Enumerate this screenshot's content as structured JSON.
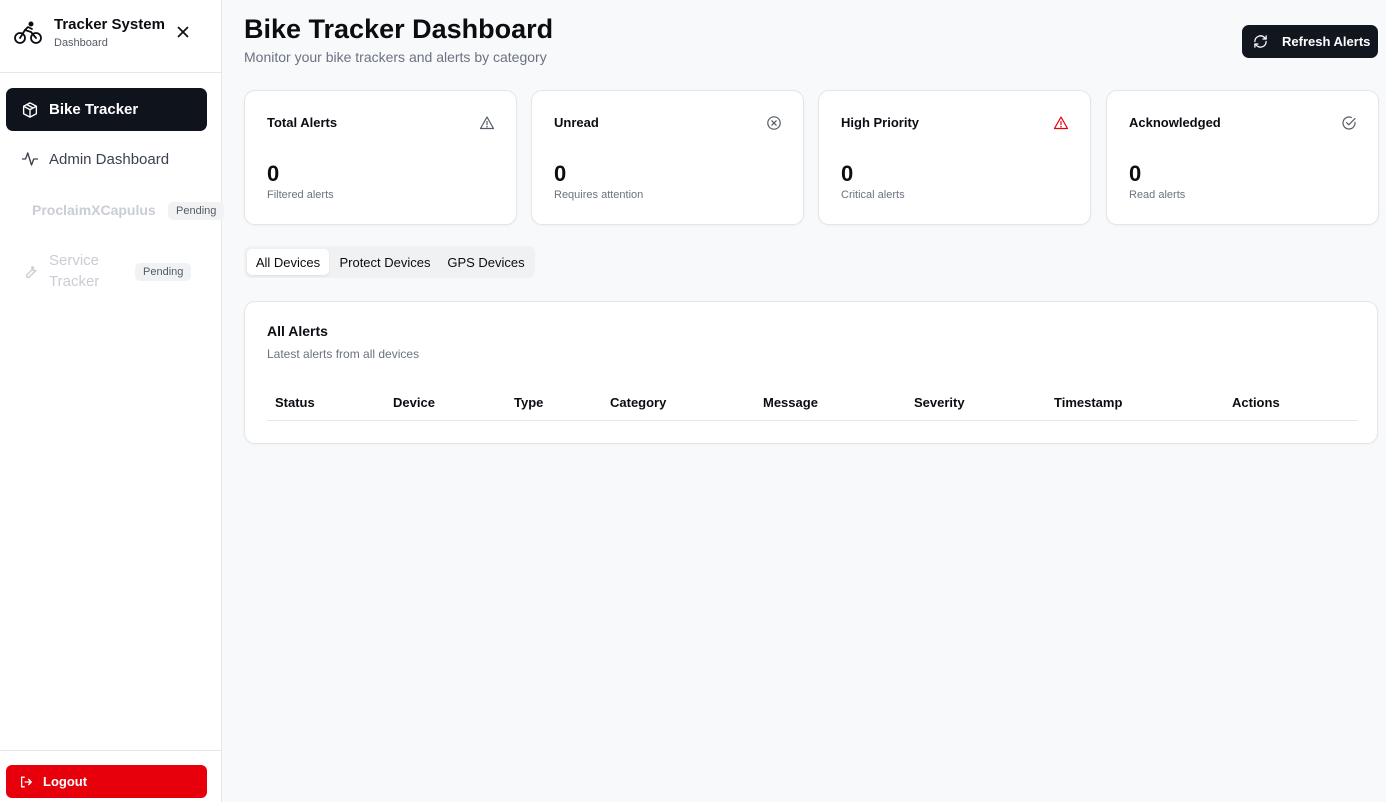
{
  "sidebar": {
    "brand": {
      "title": "Tracker System",
      "subtitle": "Dashboard",
      "icon": "bike-icon"
    },
    "items": [
      {
        "label": "Bike Tracker",
        "icon": "package-icon",
        "active": true
      },
      {
        "label": "Admin Dashboard",
        "icon": "activity-icon",
        "active": false
      },
      {
        "label": "ProclaimXCapulus",
        "badge": "Pending",
        "disabled": true
      },
      {
        "label": "Service Tracker",
        "icon": "wrench-icon",
        "badge": "Pending",
        "disabled": true
      }
    ],
    "logout_label": "Logout"
  },
  "header": {
    "title": "Bike Tracker Dashboard",
    "subtitle": "Monitor your bike trackers and alerts by category",
    "refresh_label": "Refresh Alerts"
  },
  "stats": [
    {
      "title": "Total Alerts",
      "value": "0",
      "note": "Filtered alerts",
      "icon": "alert-triangle-icon"
    },
    {
      "title": "Unread",
      "value": "0",
      "note": "Requires attention",
      "icon": "x-circle-icon"
    },
    {
      "title": "High Priority",
      "value": "0",
      "note": "Critical alerts",
      "icon": "alert-triangle-red-icon"
    },
    {
      "title": "Acknowledged",
      "value": "0",
      "note": "Read alerts",
      "icon": "check-circle-icon"
    }
  ],
  "tabs": [
    {
      "label": "All Devices",
      "active": true
    },
    {
      "label": "Protect Devices",
      "active": false
    },
    {
      "label": "GPS Devices",
      "active": false
    }
  ],
  "alerts_panel": {
    "title": "All Alerts",
    "subtitle": "Latest alerts from all devices",
    "columns": [
      "Status",
      "Device",
      "Type",
      "Category",
      "Message",
      "Severity",
      "Timestamp",
      "Actions"
    ],
    "rows": []
  },
  "colors": {
    "primary_dark": "#0f131c",
    "danger": "#e7000b",
    "high_priority_icon": "#e7000b"
  }
}
